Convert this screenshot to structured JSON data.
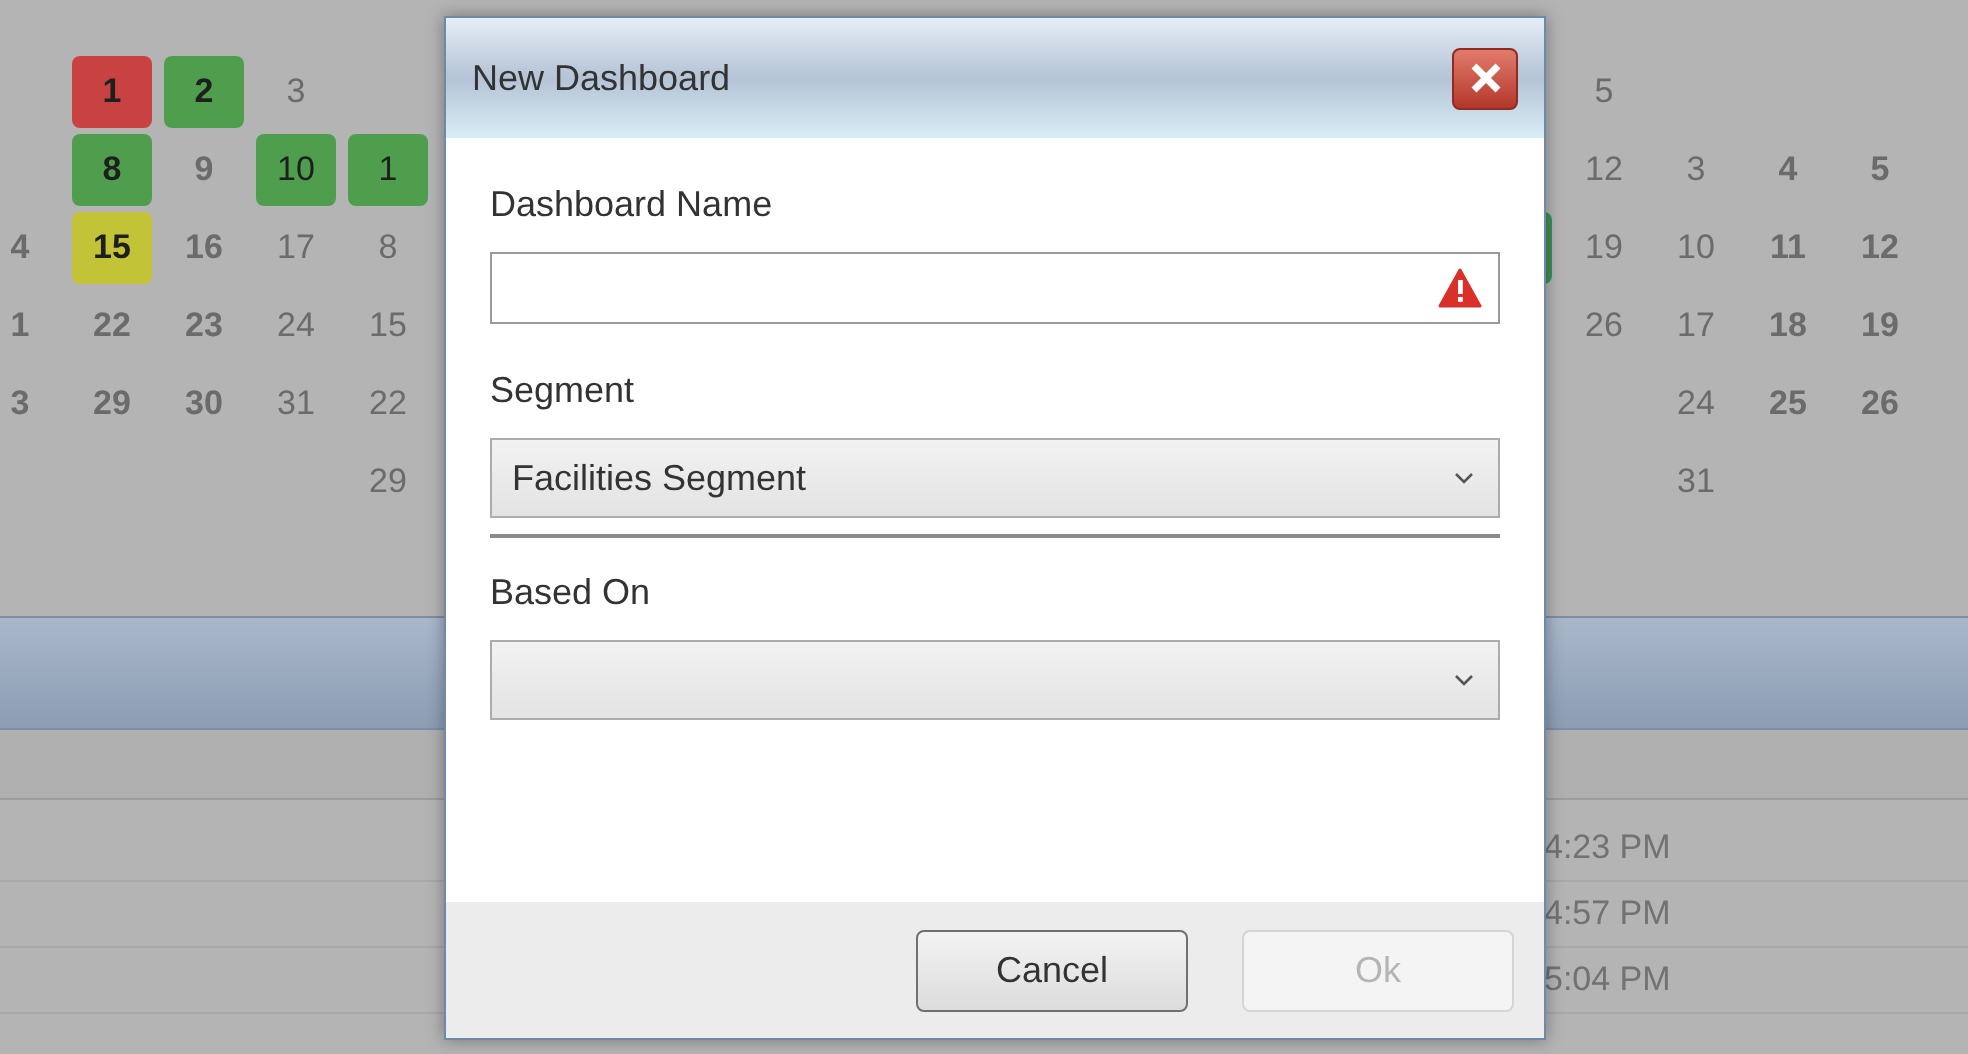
{
  "calendar_left": {
    "rows": [
      [
        {},
        {
          "text": "1",
          "bold": true,
          "color": "#c94242"
        },
        {
          "text": "2",
          "bold": true,
          "color": "#4e9e4e"
        },
        {
          "text": "3",
          "bold": false
        },
        {}
      ],
      [
        {},
        {
          "text": "8",
          "bold": true,
          "color": "#4e9e4e"
        },
        {
          "text": "9",
          "bold": true
        },
        {
          "text": "10",
          "bold": false,
          "color": "#4e9e4e"
        },
        {
          "text": "1",
          "bold": false,
          "color": "#4e9e4e"
        }
      ],
      [
        {
          "text": "4",
          "bold": true
        },
        {
          "text": "15",
          "bold": true,
          "color": "#c3c338"
        },
        {
          "text": "16",
          "bold": true
        },
        {
          "text": "17",
          "bold": false
        },
        {
          "text": "8",
          "bold": false
        }
      ],
      [
        {
          "text": "1",
          "bold": true
        },
        {
          "text": "22",
          "bold": true
        },
        {
          "text": "23",
          "bold": true
        },
        {
          "text": "24",
          "bold": false
        },
        {
          "text": "15",
          "bold": false
        }
      ],
      [
        {
          "text": "3",
          "bold": true
        },
        {
          "text": "29",
          "bold": true
        },
        {
          "text": "30",
          "bold": true
        },
        {
          "text": "31",
          "bold": false
        },
        {
          "text": "22",
          "bold": false
        }
      ],
      [
        {},
        {},
        {},
        {},
        {
          "text": "29",
          "bold": false
        }
      ]
    ]
  },
  "calendar_right": {
    "rows": [
      [
        {},
        {
          "text": "5",
          "bold": false
        },
        {},
        {},
        {}
      ],
      [
        {},
        {
          "text": "12",
          "bold": false
        },
        {
          "text": "3",
          "bold": false
        },
        {
          "text": "4",
          "bold": true
        },
        {
          "text": "5",
          "bold": true
        }
      ],
      [
        {
          "color": "#3f8f5a"
        },
        {
          "text": "19",
          "bold": false
        },
        {
          "text": "10",
          "bold": false
        },
        {
          "text": "11",
          "bold": true
        },
        {
          "text": "12",
          "bold": true
        }
      ],
      [
        {},
        {
          "text": "26",
          "bold": false
        },
        {
          "text": "17",
          "bold": false
        },
        {
          "text": "18",
          "bold": true
        },
        {
          "text": "19",
          "bold": true
        }
      ],
      [
        {},
        {},
        {
          "text": "24",
          "bold": false
        },
        {
          "text": "25",
          "bold": true
        },
        {
          "text": "26",
          "bold": true
        }
      ],
      [
        {},
        {},
        {
          "text": "31",
          "bold": false
        },
        {},
        {}
      ]
    ]
  },
  "list": {
    "rows": [
      {
        "time": "4:23 PM"
      },
      {
        "time": "4:57 PM"
      },
      {
        "time": "5:04 PM"
      }
    ]
  },
  "dialog": {
    "title": "New Dashboard",
    "fields": [
      {
        "kind": "text",
        "label": "Dashboard Name",
        "error": true
      },
      {
        "kind": "select",
        "label": "Segment",
        "value": "Facilities Segment"
      },
      {
        "kind": "select",
        "label": "Based On"
      }
    ],
    "buttons": [
      {
        "label": "Cancel",
        "disabled": false
      },
      {
        "label": "Ok",
        "disabled": true
      }
    ]
  }
}
